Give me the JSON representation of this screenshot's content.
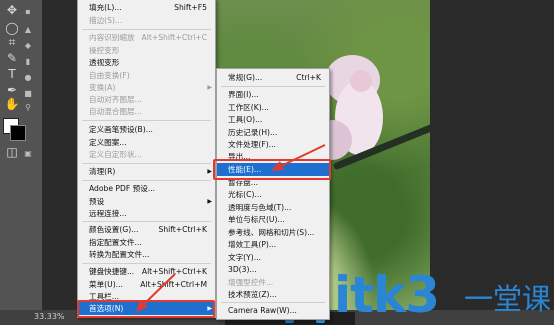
{
  "colors": {
    "menu_bg": "#f0f0f0",
    "highlight": "#1f6fd1",
    "annotation_red": "#e23b2e",
    "watermark": "#2a86d4"
  },
  "status": {
    "zoom": "33.33%"
  },
  "edit_menu": {
    "items": [
      {
        "label": "填充(L)...",
        "shortcut": "Shift+F5",
        "disabled": false
      },
      {
        "label": "描边(S)...",
        "shortcut": "",
        "disabled": true
      },
      {
        "label": "内容识别缩放",
        "shortcut": "Alt+Shift+Ctrl+C",
        "disabled": true
      },
      {
        "label": "操控变形",
        "shortcut": "",
        "disabled": true
      },
      {
        "label": "透视变形",
        "shortcut": "",
        "disabled": false
      },
      {
        "label": "自由变换(F)",
        "shortcut": "",
        "disabled": true
      },
      {
        "label": "变换(A)",
        "shortcut": "",
        "disabled": true,
        "submenu": true
      },
      {
        "label": "自动对齐图层...",
        "shortcut": "",
        "disabled": true
      },
      {
        "label": "自动混合图层...",
        "shortcut": "",
        "disabled": true
      },
      {
        "label": "定义画笔预设(B)...",
        "shortcut": "",
        "disabled": false
      },
      {
        "label": "定义图案...",
        "shortcut": "",
        "disabled": false
      },
      {
        "label": "定义自定形状...",
        "shortcut": "",
        "disabled": true
      },
      {
        "label": "清理(R)",
        "shortcut": "",
        "disabled": false,
        "submenu": true
      },
      {
        "label": "Adobe PDF 预设...",
        "shortcut": "",
        "disabled": false
      },
      {
        "label": "预设",
        "shortcut": "",
        "disabled": false,
        "submenu": true
      },
      {
        "label": "远程连接...",
        "shortcut": "",
        "disabled": false
      },
      {
        "label": "颜色设置(G)...",
        "shortcut": "Shift+Ctrl+K",
        "disabled": false
      },
      {
        "label": "指定配置文件...",
        "shortcut": "",
        "disabled": false
      },
      {
        "label": "转换为配置文件...",
        "shortcut": "",
        "disabled": false
      },
      {
        "label": "键盘快捷键...",
        "shortcut": "Alt+Shift+Ctrl+K",
        "disabled": false
      },
      {
        "label": "菜单(U)...",
        "shortcut": "Alt+Shift+Ctrl+M",
        "disabled": false
      },
      {
        "label": "工具栏...",
        "shortcut": "",
        "disabled": false
      },
      {
        "label": "首选项(N)",
        "shortcut": "",
        "disabled": false,
        "submenu": true,
        "highlighted": true
      }
    ]
  },
  "prefs_menu": {
    "items": [
      {
        "label": "常规(G)...",
        "shortcut": "Ctrl+K",
        "disabled": false
      },
      {
        "label": "界面(I)...",
        "shortcut": "",
        "disabled": false
      },
      {
        "label": "工作区(K)...",
        "shortcut": "",
        "disabled": false
      },
      {
        "label": "工具(O)...",
        "shortcut": "",
        "disabled": false
      },
      {
        "label": "历史记录(H)...",
        "shortcut": "",
        "disabled": false
      },
      {
        "label": "文件处理(F)...",
        "shortcut": "",
        "disabled": false
      },
      {
        "label": "导出...",
        "shortcut": "",
        "disabled": false
      },
      {
        "label": "性能(E)...",
        "shortcut": "",
        "disabled": false,
        "highlighted": true
      },
      {
        "label": "暂存盘...",
        "shortcut": "",
        "disabled": false
      },
      {
        "label": "光标(C)...",
        "shortcut": "",
        "disabled": false
      },
      {
        "label": "透明度与色域(T)...",
        "shortcut": "",
        "disabled": false
      },
      {
        "label": "单位与标尺(U)...",
        "shortcut": "",
        "disabled": false
      },
      {
        "label": "参考线、网格和切片(S)...",
        "shortcut": "",
        "disabled": false
      },
      {
        "label": "增效工具(P)...",
        "shortcut": "",
        "disabled": false
      },
      {
        "label": "文字(Y)...",
        "shortcut": "",
        "disabled": false
      },
      {
        "label": "3D(3)...",
        "shortcut": "",
        "disabled": false
      },
      {
        "label": "增强型控件...",
        "shortcut": "",
        "disabled": true
      },
      {
        "label": "技术预览(Z)...",
        "shortcut": "",
        "disabled": false
      },
      {
        "label": "Camera Raw(W)...",
        "shortcut": "",
        "disabled": false
      }
    ]
  },
  "watermark": {
    "text": "itk3",
    "cn": "一堂课"
  },
  "tools": [
    "move-tool",
    "lasso-tool",
    "crop-tool",
    "eyedropper-tool",
    "healing-tool",
    "brush-tool",
    "clone-tool",
    "history-brush-tool",
    "eraser-tool",
    "gradient-tool",
    "blur-tool",
    "dodge-tool",
    "pen-tool",
    "type-tool",
    "path-select-tool",
    "shape-tool",
    "hand-tool",
    "zoom-tool"
  ]
}
